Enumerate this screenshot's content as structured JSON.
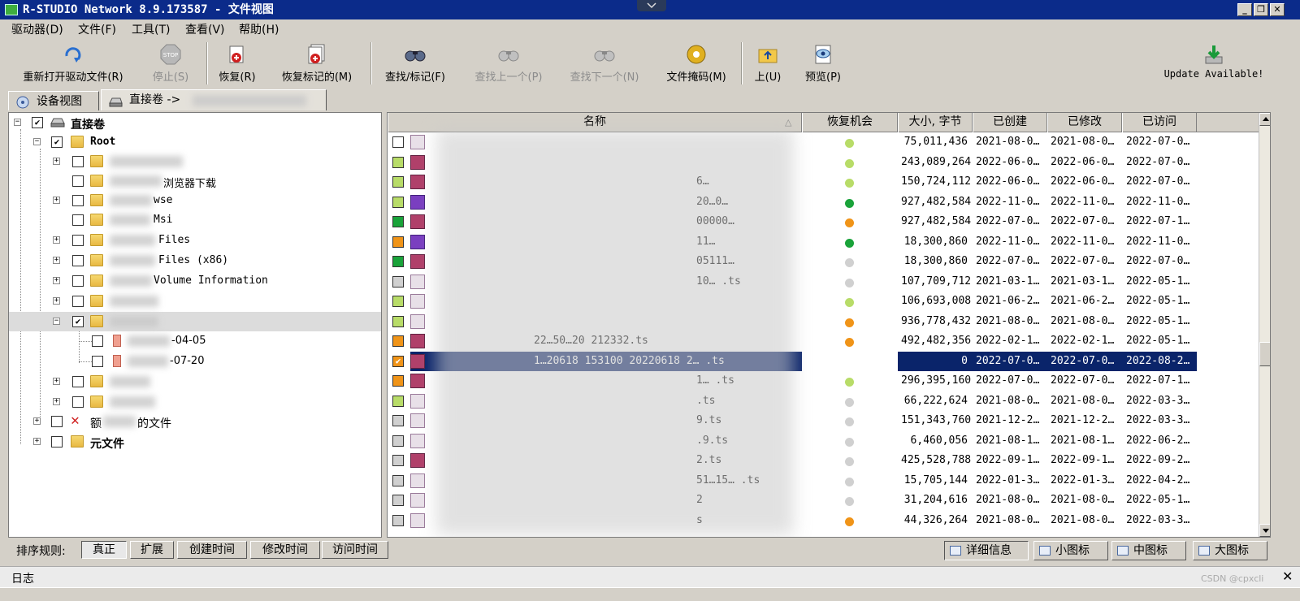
{
  "window": {
    "title": "R-STUDIO Network 8.9.173587 - 文件视图"
  },
  "menu": [
    "驱动器(D)",
    "文件(F)",
    "工具(T)",
    "查看(V)",
    "帮助(H)"
  ],
  "toolbar": {
    "reopen": "重新打开驱动文件(R)",
    "stop": "停止(S)",
    "recover": "恢复(R)",
    "recover_marked": "恢复标记的(M)",
    "find_mark": "查找/标记(F)",
    "find_prev": "查找上一个(P)",
    "find_next": "查找下一个(N)",
    "file_mask": "文件掩码(M)",
    "up": "上(U)",
    "preview": "预览(P)",
    "update": "Update Available!"
  },
  "tabs": {
    "devices": "设备视图",
    "direct": "直接卷 ->"
  },
  "tree": {
    "root_volume": "直接卷",
    "root": "Root",
    "items": [
      "浏览器下载",
      "wse",
      "Msi",
      "Files",
      "Files (x86)",
      "Volume Information",
      "-04-05",
      "-07-20"
    ],
    "extra_files": "额外找到的文件",
    "extra_prefix": "额",
    "extra_suffix": "的文件",
    "meta_files": "元文件"
  },
  "columns": {
    "name": "名称",
    "chance": "恢复机会",
    "size": "大小, 字节",
    "created": "已创建",
    "modified": "已修改",
    "accessed": "已访问"
  },
  "colors": {
    "green": "#7cc84a",
    "light_green": "#b8dc68",
    "dark_green": "#1aa33a",
    "orange": "#f09418",
    "gray": "#d0d0d0",
    "selection": "#0a246a"
  },
  "files": [
    {
      "name": "",
      "size": "75,011,436",
      "created": "2021-08-0…",
      "modified": "2021-08-0…",
      "accessed": "2022-07-0…"
    },
    {
      "name": "",
      "size": "243,089,264",
      "created": "2022-06-0…",
      "modified": "2022-06-0…",
      "accessed": "2022-07-0…"
    },
    {
      "name": "6…",
      "size": "150,724,112",
      "created": "2022-06-0…",
      "modified": "2022-06-0…",
      "accessed": "2022-07-0…"
    },
    {
      "name": "20…0…",
      "size": "927,482,584",
      "created": "2022-11-0…",
      "modified": "2022-11-0…",
      "accessed": "2022-11-0…"
    },
    {
      "name": "00000…",
      "size": "927,482,584",
      "created": "2022-07-0…",
      "modified": "2022-07-0…",
      "accessed": "2022-07-1…"
    },
    {
      "name": "11…",
      "size": "18,300,860",
      "created": "2022-11-0…",
      "modified": "2022-11-0…",
      "accessed": "2022-11-0…"
    },
    {
      "name": "05111…",
      "size": "18,300,860",
      "created": "2022-07-0…",
      "modified": "2022-07-0…",
      "accessed": "2022-07-0…"
    },
    {
      "name": "10…  .ts",
      "size": "107,709,712",
      "created": "2021-03-1…",
      "modified": "2021-03-1…",
      "accessed": "2022-05-1…"
    },
    {
      "name": "",
      "size": "106,693,008",
      "created": "2021-06-2…",
      "modified": "2021-06-2…",
      "accessed": "2022-05-1…"
    },
    {
      "name": "",
      "size": "936,778,432",
      "created": "2021-08-0…",
      "modified": "2021-08-0…",
      "accessed": "2022-05-1…"
    },
    {
      "name": "22…50…20 212332.ts",
      "size": "492,482,356",
      "created": "2022-02-1…",
      "modified": "2022-02-1…",
      "accessed": "2022-05-1…"
    },
    {
      "name": "1…20618 153100 20220618 2…  .ts",
      "size": "0",
      "created": "2022-07-0…",
      "modified": "2022-07-0…",
      "accessed": "2022-08-2…"
    },
    {
      "name": "1…  .ts",
      "size": "296,395,160",
      "created": "2022-07-0…",
      "modified": "2022-07-0…",
      "accessed": "2022-07-1…"
    },
    {
      "name": ".ts",
      "size": "66,222,624",
      "created": "2021-08-0…",
      "modified": "2021-08-0…",
      "accessed": "2022-03-3…"
    },
    {
      "name": "9.ts",
      "size": "151,343,760",
      "created": "2021-12-2…",
      "modified": "2021-12-2…",
      "accessed": "2022-03-3…"
    },
    {
      "name": ".9.ts",
      "size": "6,460,056",
      "created": "2021-08-1…",
      "modified": "2021-08-1…",
      "accessed": "2022-06-2…"
    },
    {
      "name": "2.ts",
      "size": "425,528,788",
      "created": "2022-09-1…",
      "modified": "2022-09-1…",
      "accessed": "2022-09-2…"
    },
    {
      "name": "51…15…  .ts",
      "size": "15,705,144",
      "created": "2022-01-3…",
      "modified": "2022-01-3…",
      "accessed": "2022-04-2…"
    },
    {
      "name": "2",
      "size": "31,204,616",
      "created": "2021-08-0…",
      "modified": "2021-08-0…",
      "accessed": "2022-05-1…"
    },
    {
      "name": "s",
      "size": "44,326,264",
      "created": "2021-08-0…",
      "modified": "2021-08-0…",
      "accessed": "2022-03-3…"
    }
  ],
  "sort": {
    "label": "排序规则:",
    "buttons": [
      "真正",
      "扩展",
      "创建时间",
      "修改时间",
      "访问时间"
    ]
  },
  "views": [
    "详细信息",
    "小图标",
    "中图标",
    "大图标"
  ],
  "log": {
    "label": "日志"
  },
  "watermark": "CSDN @cpxcli"
}
